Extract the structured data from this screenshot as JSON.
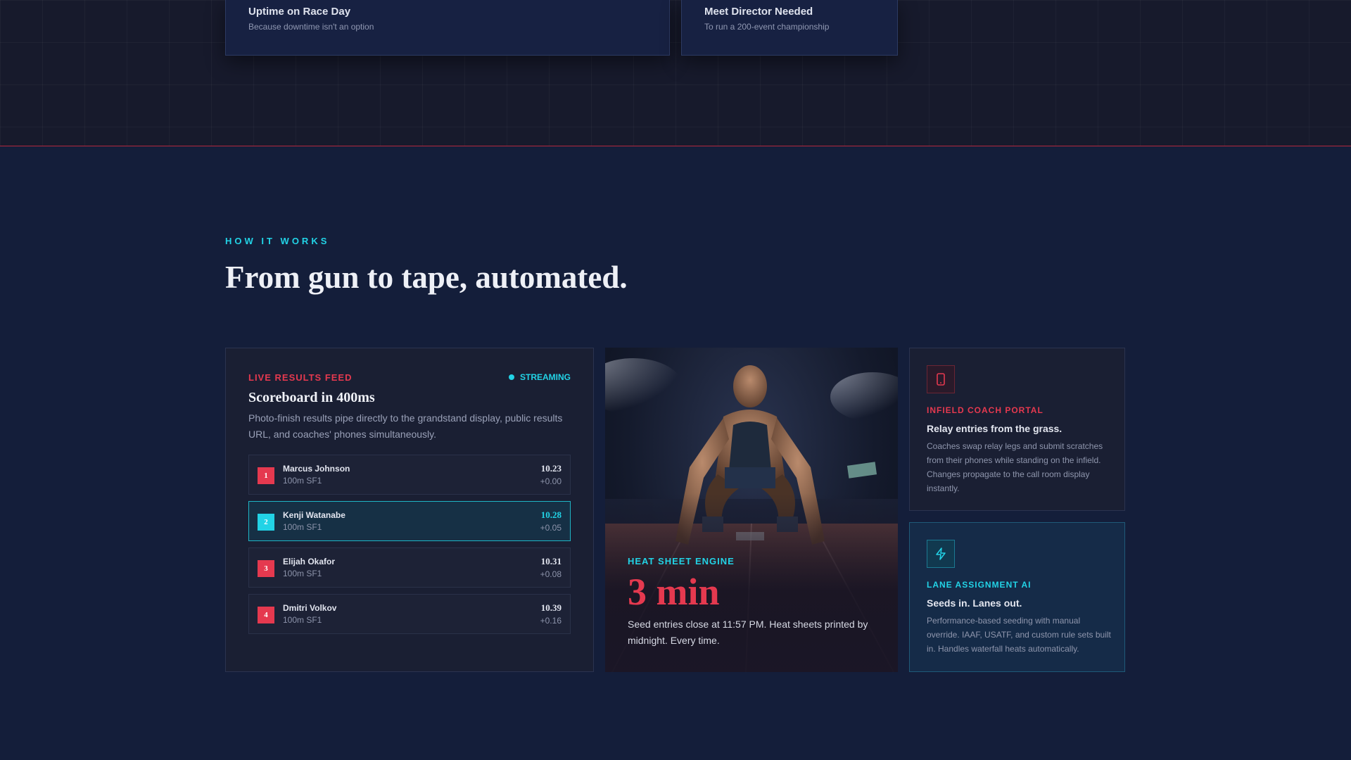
{
  "top_stats": [
    {
      "title": "Uptime on Race Day",
      "subtitle": "Because downtime isn't an option"
    },
    {
      "title": "Meet Director Needed",
      "subtitle": "To run a 200-event championship"
    }
  ],
  "section": {
    "eyebrow": "HOW IT WORKS",
    "title": "From gun to tape, automated."
  },
  "results_card": {
    "kicker": "LIVE RESULTS FEED",
    "status": "STREAMING",
    "title": "Scoreboard in 400ms",
    "description": "Photo-finish results pipe directly to the grandstand display, public results URL, and coaches' phones simultaneously.",
    "rows": [
      {
        "rank": "1",
        "name": "Marcus Johnson",
        "event": "100m SF1",
        "time": "10.23",
        "delta": "+0.00",
        "active": false
      },
      {
        "rank": "2",
        "name": "Kenji Watanabe",
        "event": "100m SF1",
        "time": "10.28",
        "delta": "+0.05",
        "active": true
      },
      {
        "rank": "3",
        "name": "Elijah Okafor",
        "event": "100m SF1",
        "time": "10.31",
        "delta": "+0.08",
        "active": false
      },
      {
        "rank": "4",
        "name": "Dmitri Volkov",
        "event": "100m SF1",
        "time": "10.39",
        "delta": "+0.16",
        "active": false
      }
    ]
  },
  "photo_card": {
    "kicker": "HEAT SHEET ENGINE",
    "stat": "3 min",
    "description": "Seed entries close at 11:57 PM. Heat sheets printed by midnight. Every time."
  },
  "features": [
    {
      "icon": "phone-icon",
      "kicker": "INFIELD COACH PORTAL",
      "title": "Relay entries from the grass.",
      "description": "Coaches swap relay legs and submit scratches from their phones while standing on the infield. Changes propagate to the call room display instantly."
    },
    {
      "icon": "lightning-icon",
      "kicker": "LANE ASSIGNMENT AI",
      "title": "Seeds in. Lanes out.",
      "description": "Performance-based seeding with manual override. IAAF, USATF, and custom rule sets built in. Handles waterfall heats automatically."
    }
  ],
  "colors": {
    "accent_red": "#e5394f",
    "accent_cyan": "#22d3e6",
    "background": "#141e3a"
  }
}
